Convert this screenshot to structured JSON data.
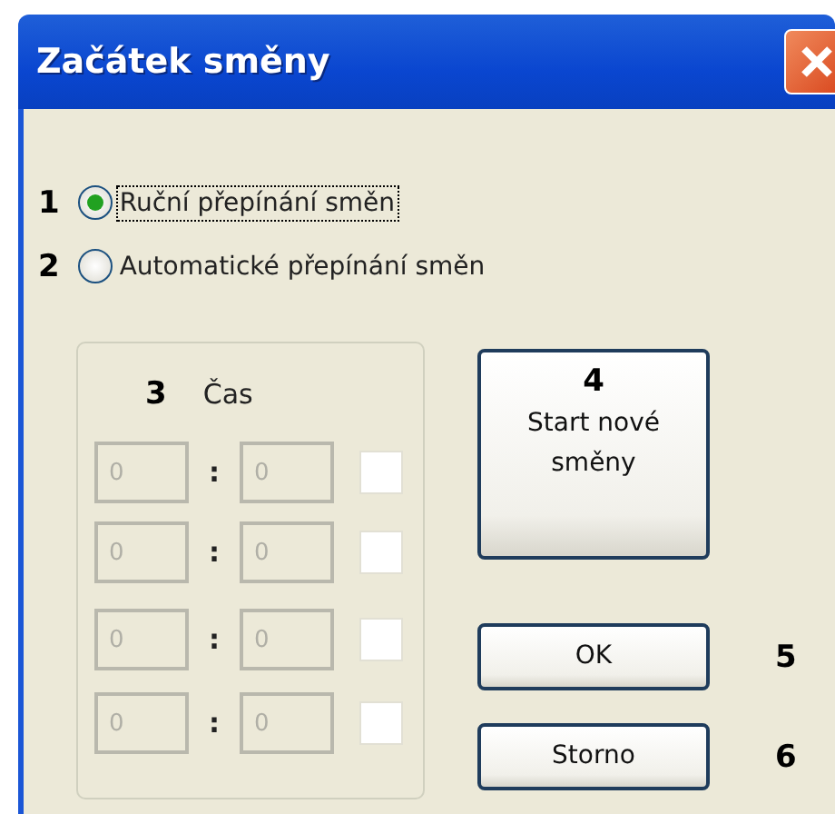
{
  "window": {
    "title": "Začátek směny"
  },
  "mode_options": [
    {
      "callout": "1",
      "label": "Ruční přepínání směn",
      "selected": true,
      "focused": true
    },
    {
      "callout": "2",
      "label": "Automatické přepínání směn",
      "selected": false,
      "focused": false
    }
  ],
  "time_group": {
    "callout": "3",
    "label": "Čas",
    "rows": [
      {
        "hours": "0",
        "separator": ":",
        "minutes": "0",
        "disabled": true,
        "checked": false
      },
      {
        "hours": "0",
        "separator": ":",
        "minutes": "0",
        "disabled": true,
        "checked": false
      },
      {
        "hours": "0",
        "separator": ":",
        "minutes": "0",
        "disabled": true,
        "checked": false
      },
      {
        "hours": "0",
        "separator": ":",
        "minutes": "0",
        "disabled": true,
        "checked": false
      }
    ]
  },
  "buttons": [
    {
      "kind": "tall",
      "callout": "4",
      "label": "Start nové směny"
    },
    {
      "kind": "wide",
      "callout": "5",
      "label": "OK"
    },
    {
      "kind": "wide",
      "callout": "6",
      "label": "Storno"
    }
  ]
}
